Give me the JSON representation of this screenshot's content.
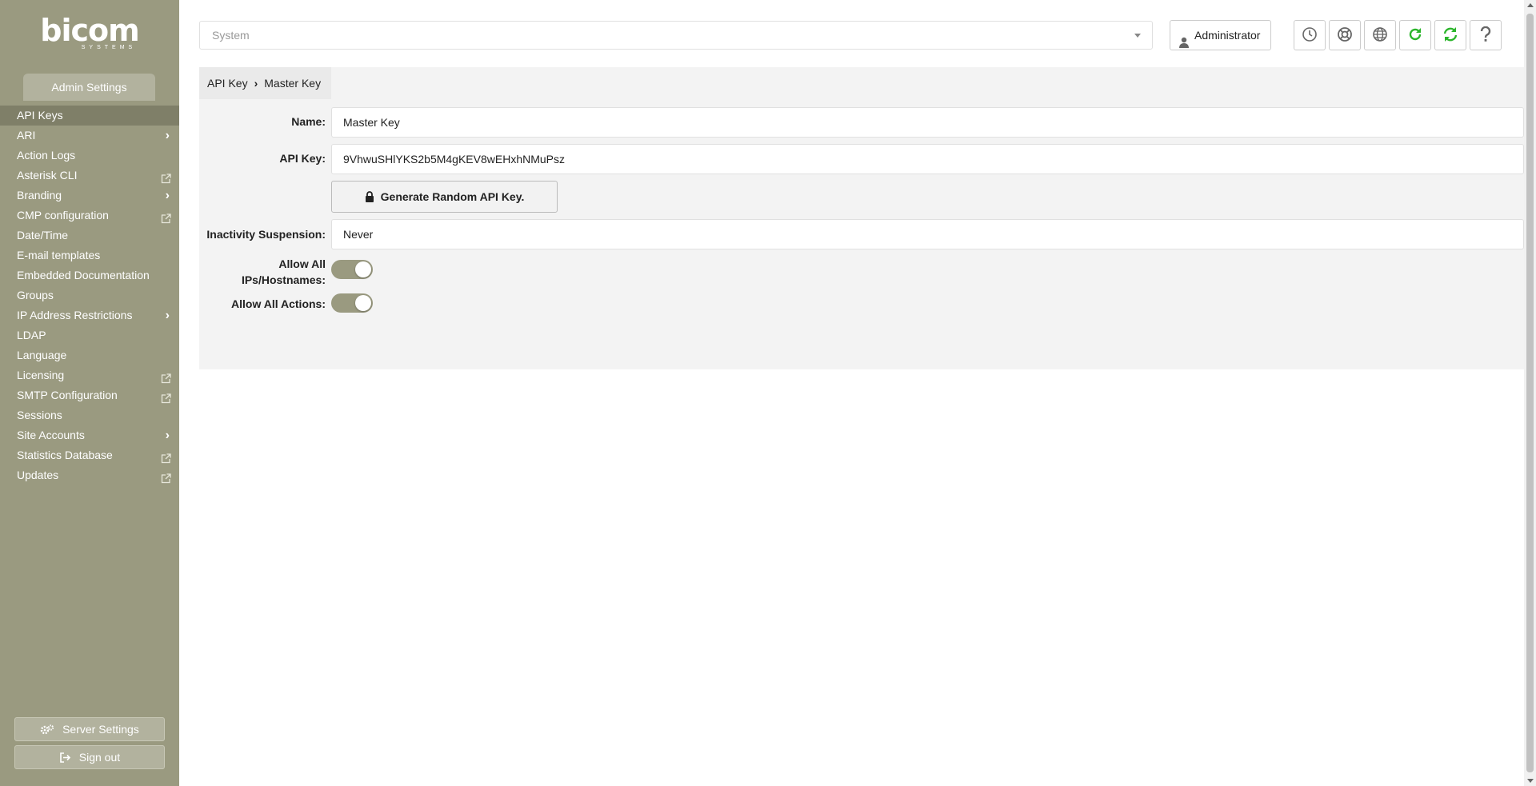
{
  "brand": {
    "logo_main": "bicom",
    "logo_sub": "SYSTEMS"
  },
  "sidebar": {
    "section_title": "Admin Settings",
    "items": [
      {
        "label": "API Keys",
        "active": true,
        "suffix": "none"
      },
      {
        "label": "ARI",
        "suffix": "chevron"
      },
      {
        "label": "Action Logs",
        "suffix": "none"
      },
      {
        "label": "Asterisk CLI",
        "suffix": "external"
      },
      {
        "label": "Branding",
        "suffix": "chevron"
      },
      {
        "label": "CMP configuration",
        "suffix": "external"
      },
      {
        "label": "Date/Time",
        "suffix": "none"
      },
      {
        "label": "E-mail templates",
        "suffix": "none"
      },
      {
        "label": "Embedded Documentation",
        "suffix": "none"
      },
      {
        "label": "Groups",
        "suffix": "none"
      },
      {
        "label": "IP Address Restrictions",
        "suffix": "chevron"
      },
      {
        "label": "LDAP",
        "suffix": "none"
      },
      {
        "label": "Language",
        "suffix": "none"
      },
      {
        "label": "Licensing",
        "suffix": "external"
      },
      {
        "label": "SMTP Configuration",
        "suffix": "external"
      },
      {
        "label": "Sessions",
        "suffix": "none"
      },
      {
        "label": "Site Accounts",
        "suffix": "chevron"
      },
      {
        "label": "Statistics Database",
        "suffix": "external"
      },
      {
        "label": "Updates",
        "suffix": "external"
      }
    ],
    "server_settings_label": "Server Settings",
    "sign_out_label": "Sign out"
  },
  "topbar": {
    "system_select_value": "System",
    "user_label": "Administrator",
    "tools": [
      "clock-icon",
      "support-icon",
      "globe-icon",
      "reload-icon",
      "sync-icon",
      "help-icon"
    ]
  },
  "breadcrumb": {
    "parent": "API Key",
    "current": "Master Key"
  },
  "form": {
    "name_label": "Name:",
    "name_value": "Master Key",
    "api_key_label": "API Key:",
    "api_key_value": "9VhwuSHlYKS2b5M4gKEV8wEHxhNMuPsz",
    "generate_label": "Generate Random API Key.",
    "inactivity_label": "Inactivity Suspension:",
    "inactivity_value": "Never",
    "allow_ips_label_1": "Allow All",
    "allow_ips_label_2": "IPs/Hostnames:",
    "allow_ips_on": true,
    "allow_actions_label": "Allow All Actions:",
    "allow_actions_on": true
  },
  "colors": {
    "sidebar": "#9a9a80",
    "accent_green": "#2bb52b",
    "panel_bg": "#f3f3f3"
  }
}
